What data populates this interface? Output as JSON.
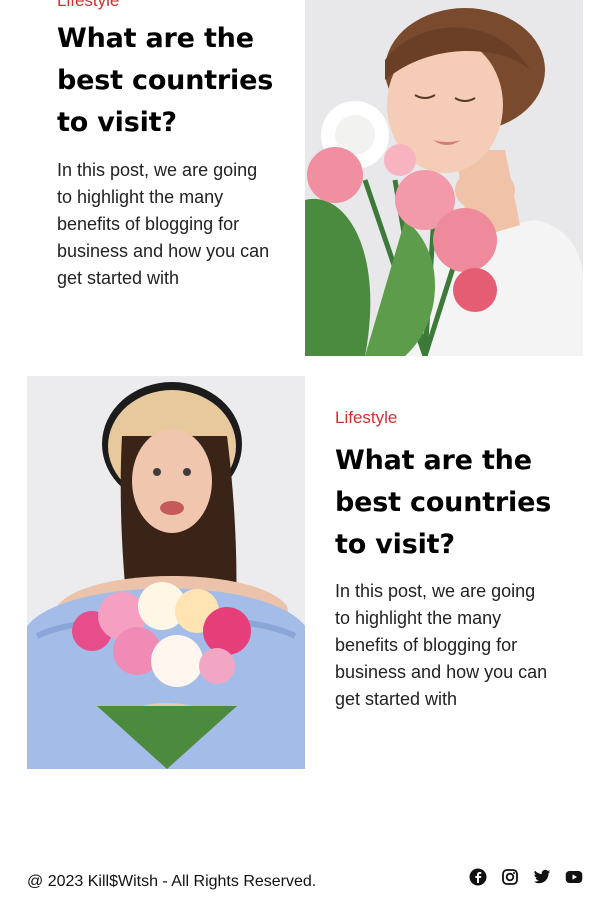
{
  "posts": [
    {
      "category": "Lifestyle",
      "title": "What are the best countries to visit?",
      "excerpt": "In this post, we are going to highlight the many benefits of blogging for business and how you can get started with"
    },
    {
      "category": "Lifestyle",
      "title": "What are the best countries to visit?",
      "excerpt": "In this post, we are going to highlight the many benefits of blogging for business and how you can get started with"
    }
  ],
  "footer": {
    "copyright": "@ 2023 Kill$Witsh - All Rights Reserved.",
    "social": [
      "facebook-icon",
      "instagram-icon",
      "twitter-icon",
      "youtube-icon"
    ]
  },
  "colors": {
    "category": "#d32f2f",
    "title": "#000000",
    "text": "#222222"
  }
}
